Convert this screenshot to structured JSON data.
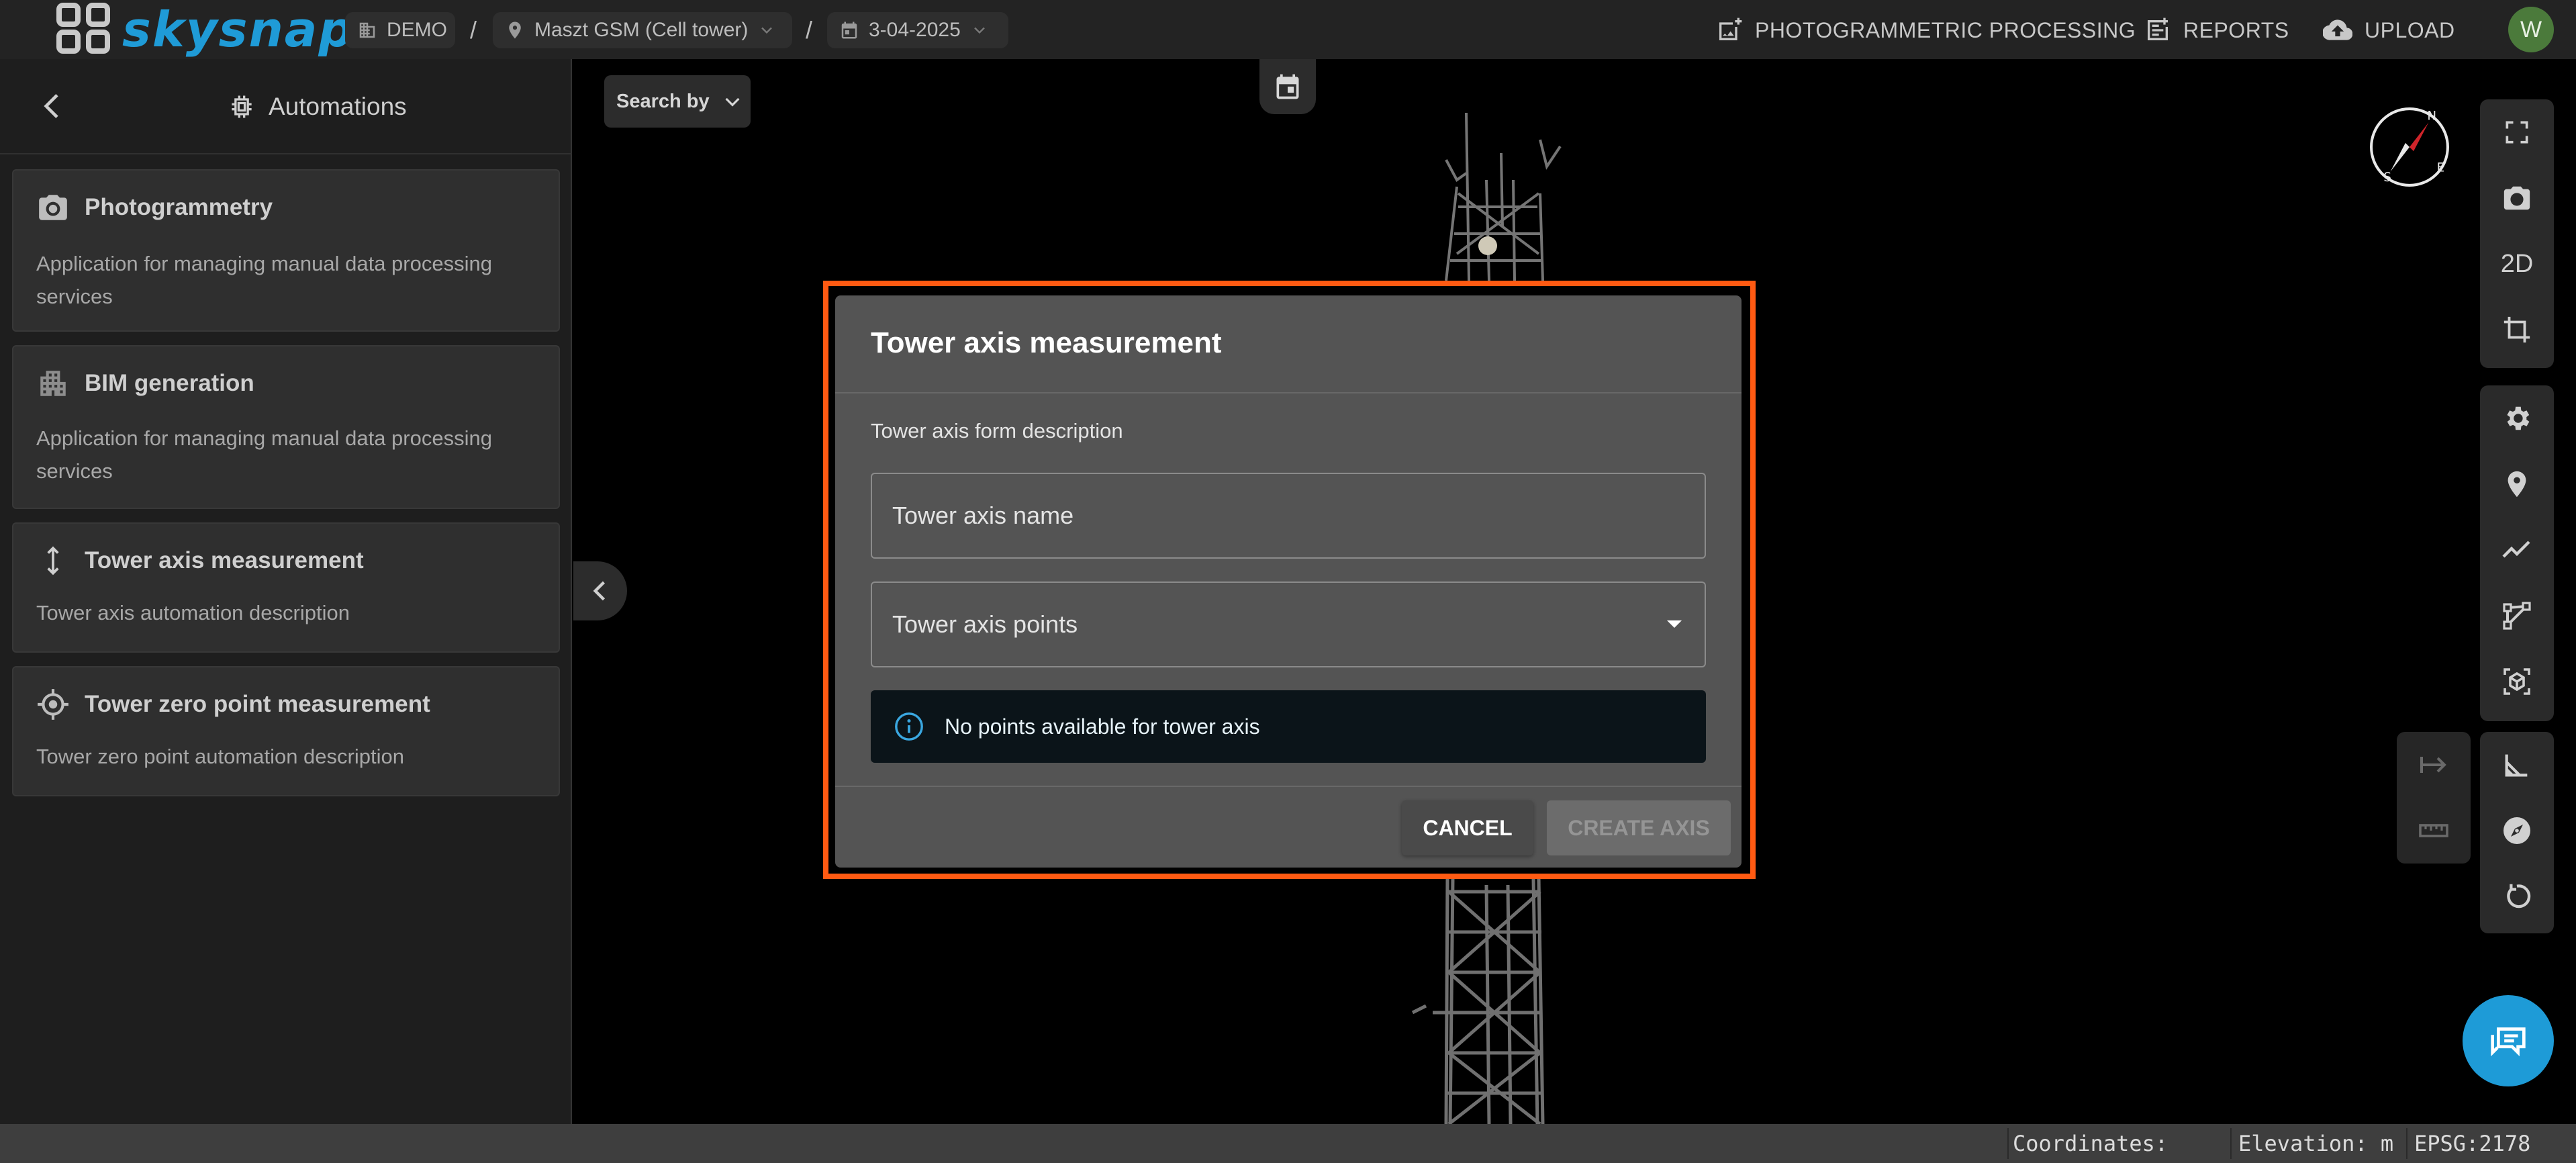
{
  "app": {
    "logo_text": "skysnap",
    "breadcrumbs": [
      {
        "label": "DEMO",
        "icon": "building-icon"
      },
      {
        "label": "Maszt GSM (Cell tower)",
        "icon": "location-pin-icon"
      },
      {
        "label": "3-04-2025",
        "icon": "calendar-icon"
      }
    ],
    "separator": "/",
    "nav": {
      "photogrammetric": "PHOTOGRAMMETRIC PROCESSING",
      "reports": "REPORTS",
      "upload": "UPLOAD"
    },
    "avatar_initial": "W",
    "brand_color": "#1f9bd7",
    "highlight_color": "#ff5a12"
  },
  "sidebar": {
    "title": "Automations",
    "cards": [
      {
        "icon": "camera-icon",
        "title": "Photogrammetry",
        "description": "Application for managing manual data processing services"
      },
      {
        "icon": "buildings-icon",
        "title": "BIM generation",
        "description": "Application for managing manual data processing services"
      },
      {
        "icon": "vertical-arrows-icon",
        "title": "Tower axis measurement",
        "description": "Tower axis automation description"
      },
      {
        "icon": "crosshair-icon",
        "title": "Tower zero point measurement",
        "description": "Tower zero point automation description"
      }
    ]
  },
  "viewer": {
    "search_by": "Search by",
    "toolbar_2d": "2D"
  },
  "statusbar": {
    "coordinates_label": "Coordinates:",
    "elevation_label": "Elevation: m",
    "epsg": "EPSG:2178"
  },
  "dialog": {
    "title": "Tower axis measurement",
    "description": "Tower axis form description",
    "name_placeholder": "Tower axis name",
    "points_placeholder": "Tower axis points",
    "info_message": "No points available for tower axis",
    "cancel_label": "CANCEL",
    "create_label": "CREATE AXIS"
  }
}
